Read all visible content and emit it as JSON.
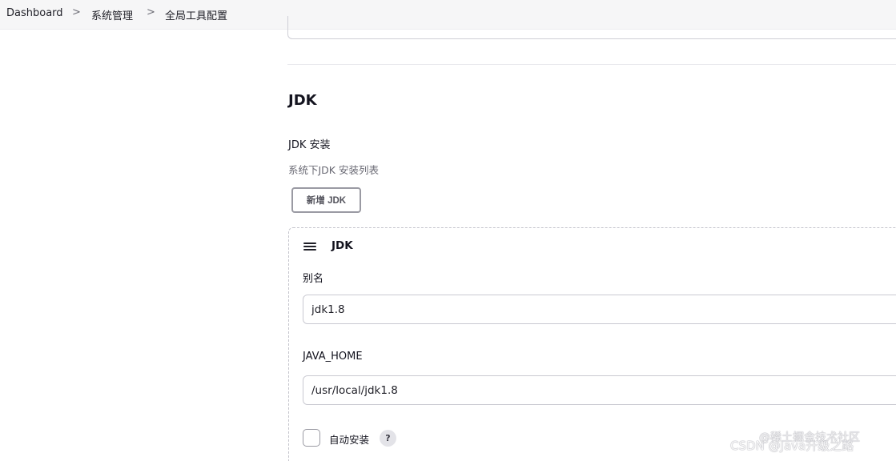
{
  "breadcrumb": {
    "items": [
      "Dashboard",
      "系统管理",
      "全局工具配置"
    ],
    "separator": ">"
  },
  "section": {
    "title": "JDK"
  },
  "jdk_install": {
    "label": "JDK 安装",
    "description": "系统下JDK 安装列表",
    "add_button_label": "新增 JDK"
  },
  "jdk_item": {
    "title": "JDK",
    "alias_label": "别名",
    "alias_value": "jdk1.8",
    "java_home_label": "JAVA_HOME",
    "java_home_value": "/usr/local/jdk1.8",
    "auto_install_label": "自动安装",
    "auto_install_checked": false,
    "help_glyph": "?"
  },
  "watermark": {
    "text": "CSDN @Java升级之路",
    "text2": "@稀土掘金技术社区"
  },
  "icons": {
    "drag_handle": "drag-handle-icon",
    "help": "help-icon",
    "chevron": "chevron-right-icon"
  }
}
